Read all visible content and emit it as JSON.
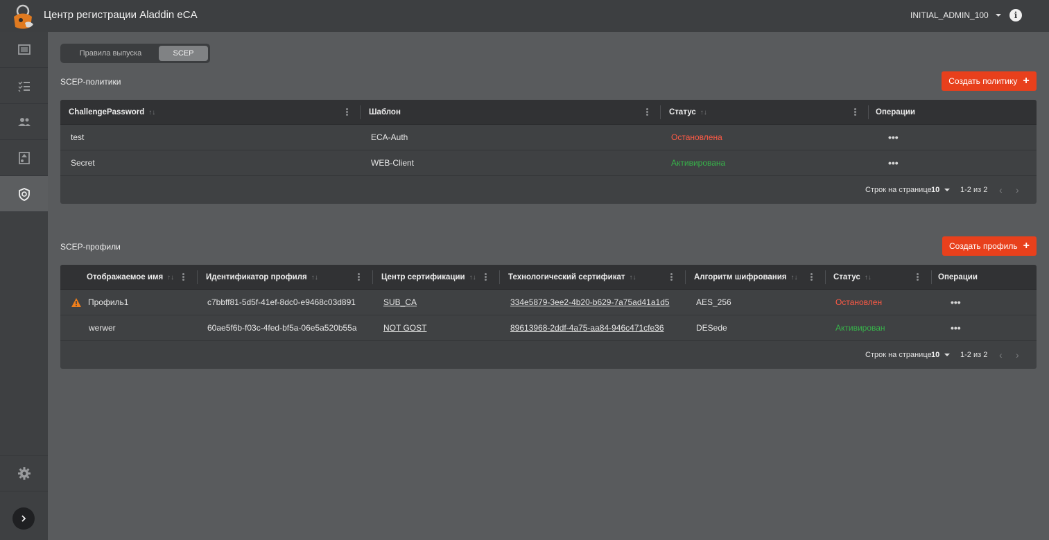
{
  "header": {
    "title": "Центр регистрации Aladdin eCA",
    "user": "INITIAL_ADMIN_100",
    "info_icon": "info-icon",
    "info_glyph": "i"
  },
  "sidebar": {
    "items": [
      {
        "icon": "dashboard-icon",
        "active": false
      },
      {
        "icon": "checklist-icon",
        "active": false
      },
      {
        "icon": "users-icon",
        "active": false
      },
      {
        "icon": "certificate-icon",
        "active": false
      },
      {
        "icon": "shield-icon",
        "active": true
      }
    ],
    "settings_icon": "gear-icon",
    "expand_icon": "chevron-right-icon"
  },
  "tabs": [
    {
      "label": "Правила выпуска",
      "selected": false
    },
    {
      "label": "SCEP",
      "selected": true
    }
  ],
  "policies": {
    "title": "SCEP-политики",
    "create_label": "Создать политику",
    "create_plus": "+",
    "columns": [
      "ChallengePassword",
      "Шаблон",
      "Статус",
      "Операции"
    ],
    "rows": [
      {
        "password": "test",
        "template": "ECA-Auth",
        "status": "Остановлена",
        "status_kind": "stopped"
      },
      {
        "password": "Secret",
        "template": "WEB-Client",
        "status": "Активирована",
        "status_kind": "active"
      }
    ],
    "pagination": {
      "rows_label": "Строк на странице",
      "rows_value": "10",
      "range": "1-2 из 2"
    }
  },
  "profiles": {
    "title": "SCEP-профили",
    "create_label": "Создать профиль",
    "create_plus": "+",
    "columns": [
      "Отображаемое имя",
      "Идентификатор профиля",
      "Центр сертификации",
      "Технологический сертификат",
      "Алгоритм шифрования",
      "Статус",
      "Операции"
    ],
    "rows": [
      {
        "name": "Профиль1",
        "warning": true,
        "id": "c7bbff81-5d5f-41ef-8dc0-e9468c03d891",
        "ca": "SUB_CA",
        "cert": "334e5879-3ee2-4b20-b629-7a75ad41a1d5",
        "algo": "AES_256",
        "status": "Остановлен",
        "status_kind": "stopped"
      },
      {
        "name": "werwer",
        "warning": false,
        "id": "60ae5f6b-f03c-4fed-bf5a-06e5a520b55a",
        "ca": "NOT GOST",
        "cert": "89613968-2ddf-4a75-aa84-946c471cfe36",
        "algo": "DESede",
        "status": "Активирован",
        "status_kind": "active"
      }
    ],
    "pagination": {
      "rows_label": "Строк на странице",
      "rows_value": "10",
      "range": "1-2 из 2"
    }
  },
  "glyphs": {
    "sort": "↑↓",
    "ops": "•••",
    "prev": "‹",
    "next": "›"
  },
  "colors": {
    "accent": "#e8401c",
    "stopped": "#ff5a45",
    "active": "#37b34a",
    "warning": "#f07f1b"
  }
}
